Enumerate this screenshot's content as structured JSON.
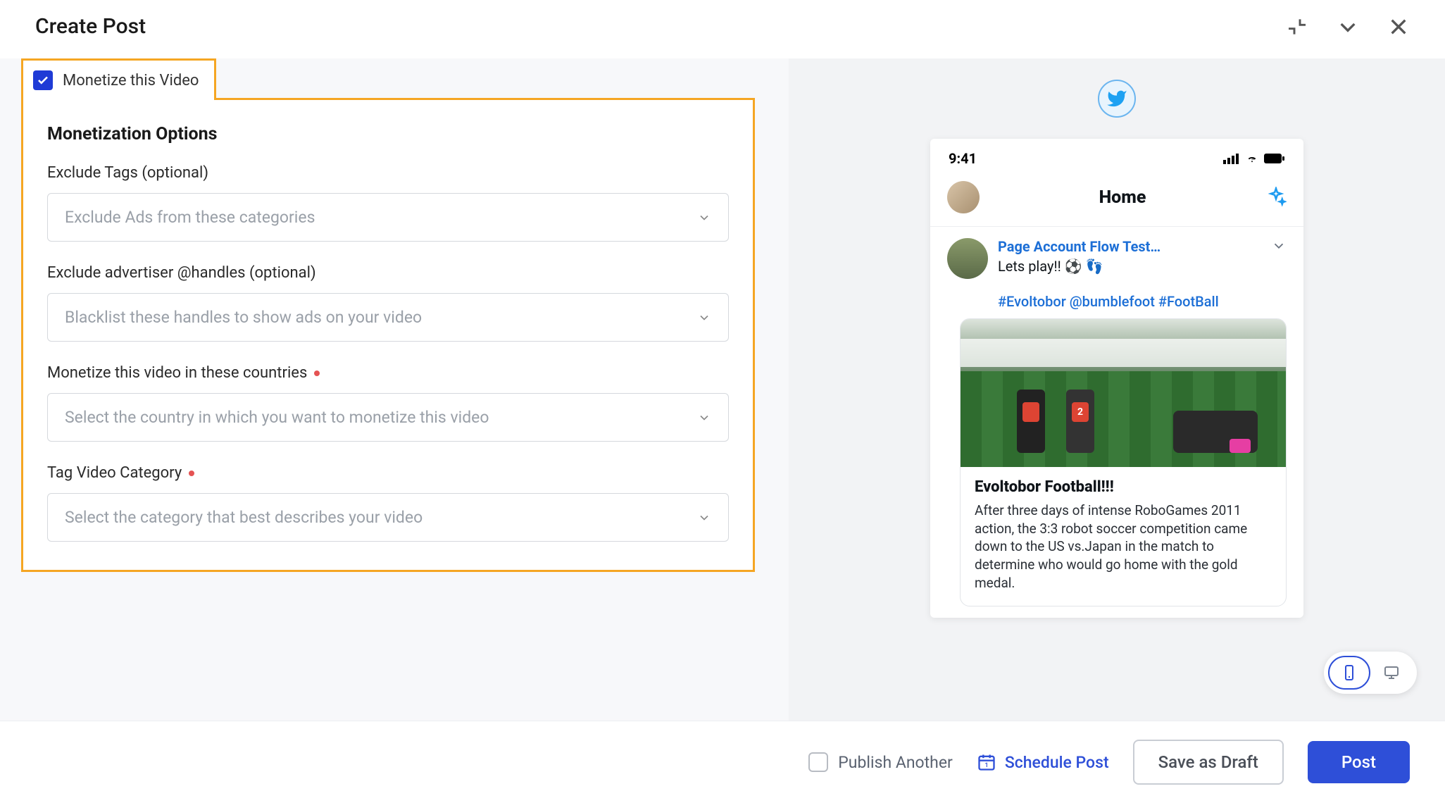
{
  "header": {
    "title": "Create Post"
  },
  "monetize": {
    "checkbox_label": "Monetize this Video",
    "checked": true
  },
  "options": {
    "title": "Monetization Options",
    "fields": {
      "exclude_tags": {
        "label": "Exclude Tags (optional)",
        "placeholder": "Exclude Ads from these categories",
        "required": false
      },
      "exclude_handles": {
        "label": "Exclude advertiser @handles (optional)",
        "placeholder": "Blacklist these handles to show ads on your video",
        "required": false
      },
      "countries": {
        "label": "Monetize this video in these countries",
        "placeholder": "Select the country in which you want to monetize this video",
        "required": true
      },
      "category": {
        "label": "Tag Video Category",
        "placeholder": "Select the category that best describes your video",
        "required": true
      }
    }
  },
  "preview": {
    "network": "twitter",
    "status_time": "9:41",
    "header_title": "Home",
    "account_name": "Page Account Flow Test…",
    "tweet_text": "Lets play!! ⚽ 👣",
    "hashtags": "#Evoltobor @bumblefoot #FootBall",
    "video": {
      "title": "Evoltobor Football!!!",
      "description": "After three days of intense RoboGames 2011 action, the 3:3 robot soccer competition came down to the US vs.Japan in the match to determine who would go home with the gold medal."
    }
  },
  "device_toggle": {
    "active": "mobile"
  },
  "footer": {
    "publish_another": "Publish Another",
    "schedule": "Schedule Post",
    "save_draft": "Save as Draft",
    "post": "Post"
  }
}
